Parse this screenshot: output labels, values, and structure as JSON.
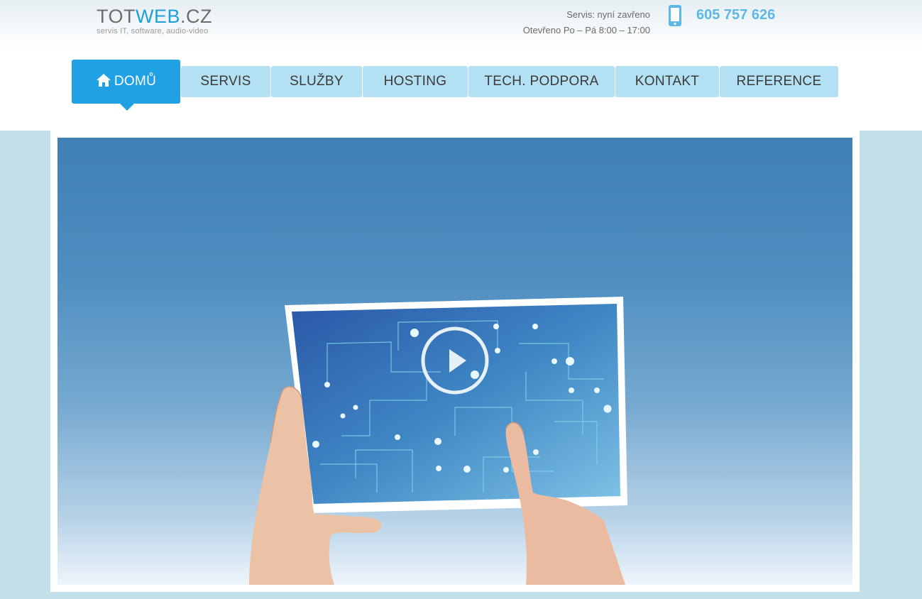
{
  "header": {
    "logo": {
      "part1": "TOT",
      "part2": "WEB",
      "part3": ".CZ",
      "tagline": "servis IT, software, audio-video"
    },
    "service_status": "Servis: nyní zavřeno",
    "opening_hours": "Otevřeno Po – Pá 8:00 – 17:00",
    "phone": "605 757 626"
  },
  "nav": {
    "items": [
      {
        "label": "DOMŮ",
        "active": true
      },
      {
        "label": "SERVIS"
      },
      {
        "label": "SLUŽBY"
      },
      {
        "label": "HOSTING"
      },
      {
        "label": "TECH. PODPORA"
      },
      {
        "label": "KONTAKT"
      },
      {
        "label": "REFERENCE"
      }
    ]
  },
  "colors": {
    "accent": "#1fa1e3",
    "nav_bg": "#b3e0f2",
    "phone": "#5db8e5",
    "page_bg": "#c2dfea"
  },
  "hero": {
    "image": "hands-holding-tablet-photo",
    "overlay_icon": "play-icon"
  }
}
